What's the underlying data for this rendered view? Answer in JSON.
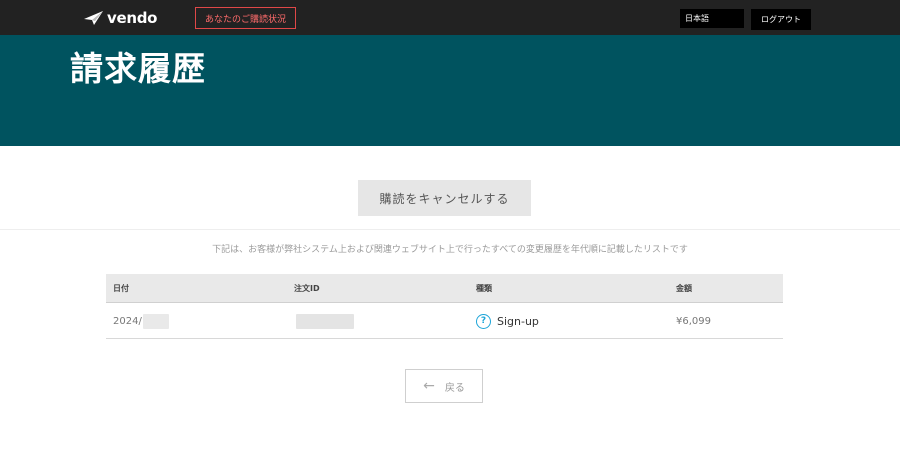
{
  "header": {
    "brand_name": "vendo",
    "status_link_label": "あなたのご購読状況",
    "language_label": "日本語",
    "logout_label": "ログアウト"
  },
  "hero": {
    "title": "請求履歴"
  },
  "main": {
    "cancel_button_label": "購読をキャンセルする",
    "description": "下記は、お客様が弊社システム上および関連ウェブサイト上で行ったすべての変更履歴を年代順に記載したリストです",
    "table": {
      "columns": [
        "日付",
        "注文ID",
        "種類",
        "金額"
      ],
      "rows": [
        {
          "date": "2024/",
          "order_id": "",
          "type": "Sign-up",
          "amount": "¥6,099"
        }
      ]
    },
    "back_button_label": "戻る"
  }
}
